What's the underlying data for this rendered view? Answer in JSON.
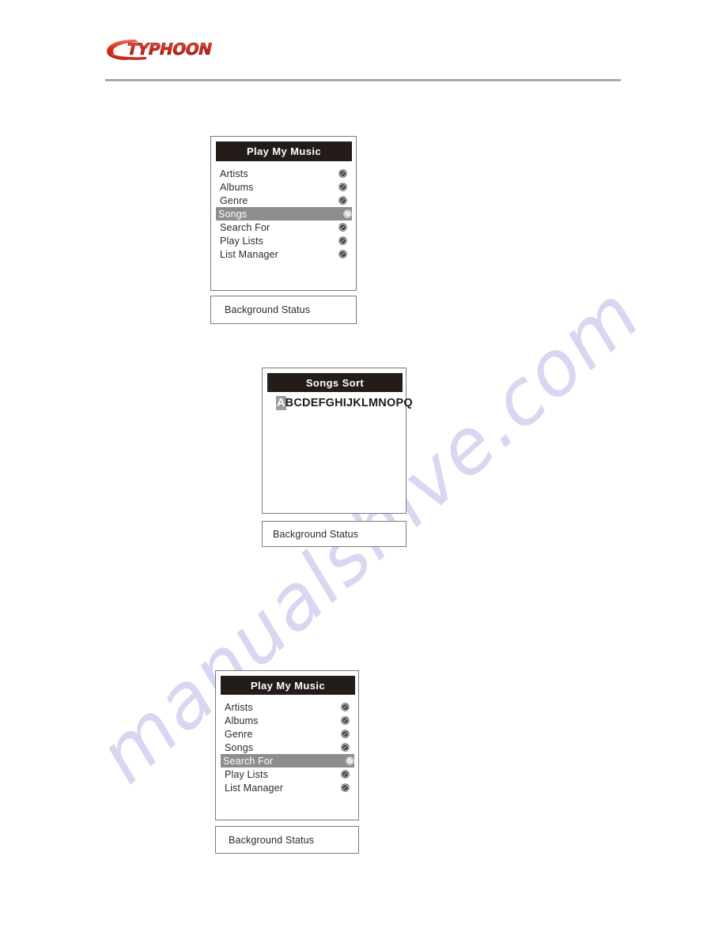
{
  "header": {
    "brand": "TYPHOON",
    "brand_color": "#d92b1c"
  },
  "watermark": {
    "text": "manualshive.com",
    "color": "#c9c9ee"
  },
  "screens": [
    {
      "id": "play-my-music-songs",
      "title": "Play  My Music",
      "type": "menu",
      "items": [
        {
          "label": "Artists",
          "icon": "navigate-icon",
          "selected": false
        },
        {
          "label": "Albums",
          "icon": "navigate-icon",
          "selected": false
        },
        {
          "label": "Genre",
          "icon": "navigate-icon",
          "selected": false
        },
        {
          "label": "Songs",
          "icon": "navigate-icon",
          "selected": true
        },
        {
          "label": "Search For",
          "icon": "navigate-icon",
          "selected": false
        },
        {
          "label": "Play Lists",
          "icon": "navigate-icon",
          "selected": false
        },
        {
          "label": "List Manager",
          "icon": "navigate-icon",
          "selected": false
        }
      ],
      "status": "Background Status"
    },
    {
      "id": "songs-sort",
      "title": "Songs   Sort",
      "type": "alphabet",
      "letters": [
        "A",
        "B",
        "C",
        "D",
        "E",
        "F",
        "G",
        "H",
        "I",
        "J",
        "K",
        "L",
        "M",
        "N",
        "O",
        "P",
        "Q"
      ],
      "selected_letter": "A",
      "status": "Background Status"
    },
    {
      "id": "play-my-music-search-for",
      "title": "Play  My Music",
      "type": "menu",
      "items": [
        {
          "label": "Artists",
          "icon": "navigate-icon",
          "selected": false
        },
        {
          "label": "Albums",
          "icon": "navigate-icon",
          "selected": false
        },
        {
          "label": "Genre",
          "icon": "navigate-icon",
          "selected": false
        },
        {
          "label": "Songs",
          "icon": "navigate-icon",
          "selected": false
        },
        {
          "label": "Search For",
          "icon": "navigate-icon",
          "selected": true
        },
        {
          "label": "Play Lists",
          "icon": "navigate-icon",
          "selected": false
        },
        {
          "label": "List Manager",
          "icon": "navigate-icon",
          "selected": false
        }
      ],
      "status": "Background Status"
    }
  ]
}
